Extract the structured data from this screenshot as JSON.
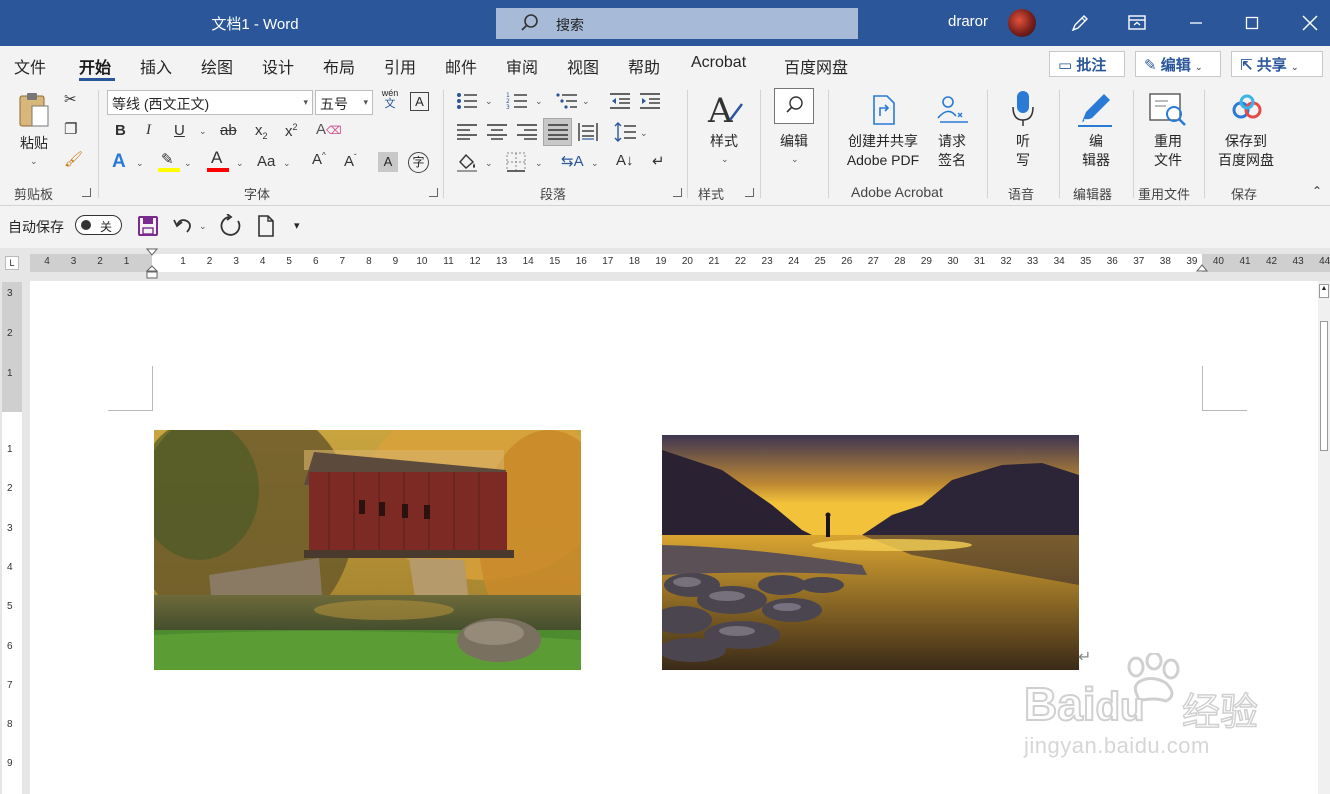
{
  "titlebar": {
    "title": "文档1  -  Word",
    "search_placeholder": "搜索",
    "user_name": "draror"
  },
  "tabs": [
    "文件",
    "开始",
    "插入",
    "绘图",
    "设计",
    "布局",
    "引用",
    "邮件",
    "审阅",
    "视图",
    "帮助",
    "Acrobat",
    "百度网盘"
  ],
  "active_tab": "开始",
  "tab_actions": {
    "comments": "批注",
    "editing": "编辑",
    "share": "共享"
  },
  "ribbon": {
    "clipboard": {
      "paste": "粘贴",
      "label": "剪贴板"
    },
    "font": {
      "name": "等线 (西文正文)",
      "size": "五号",
      "label": "字体",
      "wen": "wén",
      "wen_char": "文"
    },
    "paragraph": {
      "label": "段落"
    },
    "styles": {
      "button": "样式",
      "label": "样式"
    },
    "editing": {
      "button": "编辑"
    },
    "acrobat": {
      "create_line1": "创建并共享",
      "create_line2": "Adobe PDF",
      "sign_line1": "请求",
      "sign_line2": "签名",
      "label": "Adobe Acrobat"
    },
    "voice": {
      "line1": "听",
      "line2": "写",
      "label": "语音"
    },
    "editor": {
      "line1": "编",
      "line2": "辑器",
      "label": "编辑器"
    },
    "reuse": {
      "line1": "重用",
      "line2": "文件",
      "label": "重用文件"
    },
    "save": {
      "line1": "保存到",
      "line2": "百度网盘",
      "label": "保存"
    }
  },
  "qat": {
    "autosave": "自动保存",
    "toggle_state": "关"
  },
  "ruler": {
    "left_numbers": [
      "4",
      "3",
      "2",
      "1"
    ],
    "numbers": [
      "1",
      "2",
      "3",
      "4",
      "5",
      "6",
      "7",
      "8",
      "9",
      "10",
      "11",
      "12",
      "13",
      "14",
      "15",
      "16",
      "17",
      "18",
      "19",
      "20",
      "21",
      "22",
      "23",
      "24",
      "25",
      "26",
      "27",
      "28",
      "29",
      "30",
      "31",
      "32",
      "33",
      "34",
      "35",
      "36",
      "37",
      "38",
      "39",
      "40",
      "41",
      "42",
      "43",
      "44"
    ],
    "vertical_top": [
      "3",
      "2",
      "1"
    ],
    "vertical": [
      "1",
      "2",
      "3",
      "4",
      "5",
      "6",
      "7",
      "8",
      "9"
    ]
  },
  "watermark": {
    "brand_latin1": "Bai",
    "brand_latin2": "du",
    "brand_cn": "经验",
    "url": "jingyan.baidu.com"
  },
  "colors": {
    "accent": "#2b579a",
    "highlight": "#ffff00",
    "font_color": "#ff0000"
  }
}
